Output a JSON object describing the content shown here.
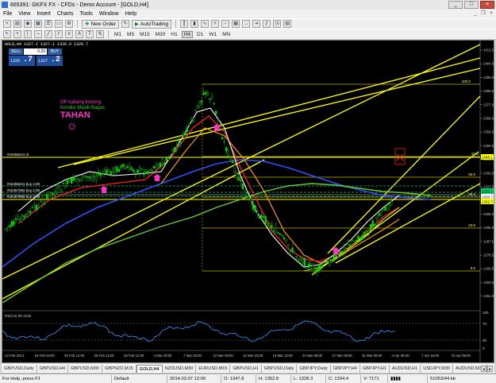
{
  "window": {
    "title": "665391: GKFX FX - CFDs - Demo Account - [GOLD,H4]",
    "minimize": "_",
    "maximize": "□",
    "close": "×"
  },
  "menu": [
    "File",
    "View",
    "Insert",
    "Charts",
    "Tools",
    "Window",
    "Help"
  ],
  "toolbar1": {
    "new_order": "New Order",
    "auto_trading": "AutoTrading"
  },
  "toolbar2": {
    "timeframes": [
      "M1",
      "M5",
      "M15",
      "M30",
      "H1",
      "H4",
      "D1",
      "W1",
      "MN"
    ]
  },
  "chart": {
    "header": "GOLD,H4  1327.1 1327.1 1326.6 1326.7",
    "trade": {
      "sell_label": "SELL",
      "buy_label": "BUY",
      "lot": "0.20",
      "sell_small": "1326",
      "sell_big": ".7",
      "buy_small": "1327",
      "buy_big": ".2"
    },
    "annotations": {
      "line1": "OP kabang kosong",
      "line2": "Kondisi Masih Bagus",
      "line3": "TAHAN",
      "line4": "☺"
    },
    "order_labels": {
      "sl": "#15456241 sl",
      "buy1": "#15456241 buy 2.00",
      "buy2": "#15457092 buy 2.00",
      "buy3": "#15457992 buy 2.00"
    },
    "fibo_labels": [
      "100.0",
      "61.8",
      "50.0",
      "38.2",
      "23.6",
      "0.0"
    ],
    "price_axis": [
      "1413.5",
      "1404.5",
      "1395.5",
      "1386.5",
      "1377.5",
      "1368.5",
      "1359.5",
      "1350.5",
      "1341.5",
      "1332.5",
      "1323.5",
      "1314.5",
      "1305.5",
      "1296.5",
      "1287.5",
      "1278.5",
      "1269.5",
      "1260.5",
      "1251.5"
    ],
    "price_tags": {
      "sl": "1348.1",
      "ask": "1335.1",
      "bid": "1326.7",
      "line": "1322.7"
    },
    "rsi": {
      "label": "RSI(14) 66.1215",
      "levels": [
        "70",
        "30"
      ],
      "axis_top": "100",
      "axis_bottom": "0"
    },
    "time_axis": [
      "13 Feb 2014",
      "18 Feb 04:00",
      "20 Feb 12:00",
      "25 Feb 12:00",
      "28 Feb 12:00",
      "4 Mar 20:00",
      "7 Mar 20:00",
      "12 Mar 08:00",
      "16 Mar 23:00",
      "19 Mar 12:00",
      "24 Mar 08:00",
      "27 Mar 08:00",
      "31 Mar 08:00",
      "3 Apr 08:00",
      "7 Apr 16:00",
      "10 Apr 08:00"
    ]
  },
  "tabs": [
    "GBPUSD,Daily",
    "GBPUSD,H4",
    "GBPUSD,M30",
    "GBPNZD,M15",
    "GOLD,H4",
    "NZDUSD,M30",
    "EURUSD,M15",
    "GBPUSD,H1",
    "GBPUSD,Daily",
    "GBPJPY,Daily",
    "GBPJPY,H4",
    "GBPJPY,H1",
    "AUDUSD,H1",
    "USDJPY,M30",
    "AUDUSD,M30"
  ],
  "active_tab": "GOLD,H4",
  "status": {
    "help": "For Help, press F1",
    "profile": "Default",
    "datetime": "2014.03.07 12:00",
    "open": "O: 1347.8",
    "high": "H: 1352.8",
    "low": "L: 1328.3",
    "close": "C: 1334.4",
    "volume": "V: 7171",
    "traffic": "51053/44 kb"
  }
}
